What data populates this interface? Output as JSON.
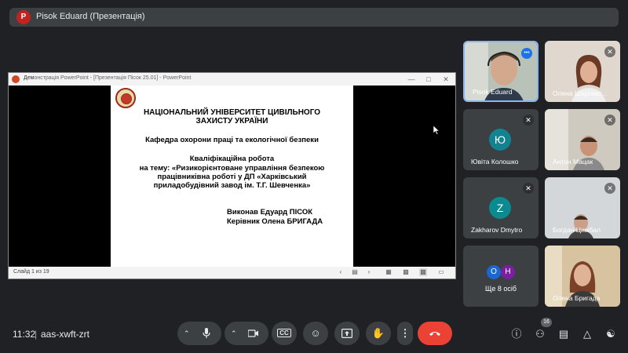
{
  "presenter_bar": {
    "avatar_letter": "P",
    "title": "Pisok Eduard (Презентація)"
  },
  "powerpoint": {
    "title_bold": "Дем",
    "title_rest": "онстрація PowerPoint - [Презентація Пісок 25.01] - PowerPoint",
    "status_slide": "Слайд 1 из 19",
    "slide": {
      "university_line1": "НАЦІОНАЛЬНИЙ УНІВЕРСИТЕТ ЦИВІЛЬНОГО",
      "university_line2": "ЗАХИСТУ УКРАЇНИ",
      "department": "Кафедра охорони праці та екологічної безпеки",
      "work_type": "Кваліфікаційна робота",
      "topic_line1": "на тему: «Ризикорієнтоване управління безпекою",
      "topic_line2": "працівниківна роботі у ДП «Харківський",
      "topic_line3": "приладобудівний завод ім. Т.Г. Шевченка»",
      "author": "Виконав Едуард ПІСОК",
      "supervisor": "Керівник Олена БРИГАДА"
    }
  },
  "participants": [
    {
      "name": "Pisok Eduard"
    },
    {
      "name": "Олена Шароват..."
    },
    {
      "name": "Ювіта Колошко",
      "avatar": "Ю",
      "avatar_color": "#12838f"
    },
    {
      "name": "Антон Мацак"
    },
    {
      "name": "Zakharov Dmytro",
      "avatar": "Z",
      "avatar_color": "#0b8a8f"
    },
    {
      "name": "Богдан Цимбал"
    },
    {
      "name": "Ще 8 осіб",
      "avatars": [
        "O",
        "H"
      ]
    },
    {
      "name": "Олена Бригада"
    }
  ],
  "bottom_bar": {
    "time": "11:32",
    "separator": "|",
    "meeting_code": "aas-xwft-zrt",
    "people_count": "16"
  },
  "colors": {
    "background": "#202124",
    "tile": "#3c4043",
    "end_call": "#ea4335",
    "speaking_border": "#8ab4f8"
  }
}
